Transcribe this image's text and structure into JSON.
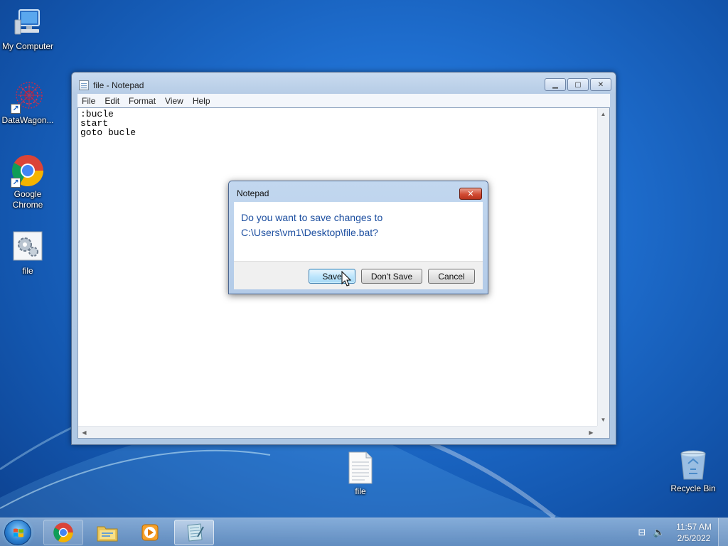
{
  "desktop": {
    "icons": [
      {
        "label": "My Computer",
        "icon": "computer-icon"
      },
      {
        "label": "DataWagon...",
        "icon": "datawagon-icon"
      },
      {
        "label": "Google Chrome",
        "icon": "chrome-icon"
      },
      {
        "label": "file",
        "icon": "batch-file-icon"
      },
      {
        "label": "file",
        "icon": "text-file-icon"
      },
      {
        "label": "Recycle Bin",
        "icon": "recycle-bin-icon"
      }
    ]
  },
  "notepad": {
    "title": "file - Notepad",
    "menu": [
      "File",
      "Edit",
      "Format",
      "View",
      "Help"
    ],
    "content": ":bucle\nstart\ngoto bucle"
  },
  "dialog": {
    "title": "Notepad",
    "message_line1": "Do you want to save changes to",
    "message_line2": "C:\\Users\\vm1\\Desktop\\file.bat?",
    "buttons": {
      "save": "Save",
      "dont_save": "Don't Save",
      "cancel": "Cancel"
    }
  },
  "taskbar": {
    "items": [
      "chrome-icon",
      "file-explorer-icon",
      "media-player-icon",
      "notepad-icon"
    ],
    "clock": {
      "time": "11:57 AM",
      "date": "2/5/2022"
    }
  },
  "colors": {
    "dialog_message": "#1d4fa0",
    "close_button": "#d24c34",
    "default_button": "#bee6fd"
  }
}
